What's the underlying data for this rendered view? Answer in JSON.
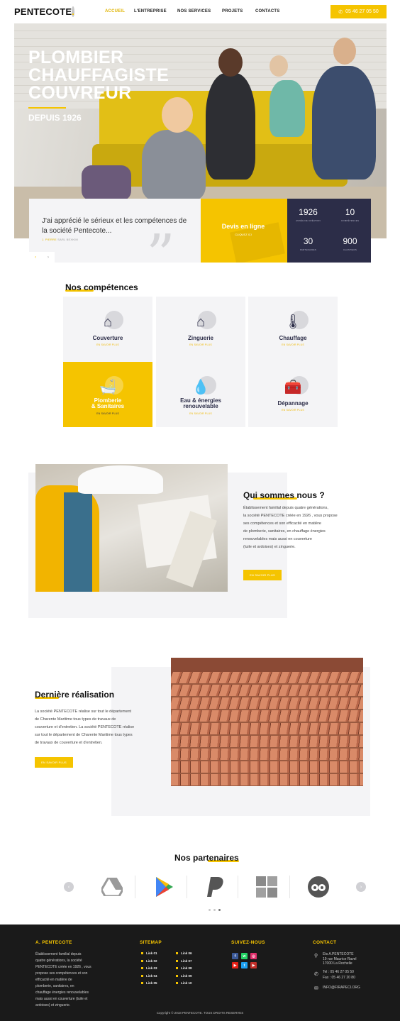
{
  "header": {
    "logo": "PENTECOTE",
    "nav": [
      "ACCUEIL",
      "L'ENTREPRISE",
      "NOS SERVICES",
      "PROJETS",
      "CONTACTS"
    ],
    "phone": "05 46 27 05 50"
  },
  "hero": {
    "title": "PLOMBIER CHAUFFAGISTE COUVREUR",
    "subtitle": "DEPUIS 1926"
  },
  "testimonial": {
    "text": "J'ai apprécié le sérieux et les compétences de la société Pentecote...",
    "author_name": "J. PIERRE",
    "author_company": "SARL BEXKIM"
  },
  "devis": {
    "title": "Devis en ligne",
    "subtitle": "CLIQUEZ ICI"
  },
  "stats": [
    {
      "value": "1926",
      "label": "ANNÉE DE CRÉATION"
    },
    {
      "value": "10",
      "label": "COMPÉTENCES"
    },
    {
      "value": "30",
      "label": "PARTENAIRES"
    },
    {
      "value": "900",
      "label": "CHANTIERS"
    }
  ],
  "competences": {
    "title": "Nos compétences",
    "more_label": "EN SAVOIR PLUS",
    "items": [
      {
        "title": "Couverture",
        "icon": "roof-tiles-icon"
      },
      {
        "title": "Zinguerie",
        "icon": "house-icon"
      },
      {
        "title": "Chauffage",
        "icon": "thermometer-icon"
      },
      {
        "title": "Plomberie",
        "title2": "& Sanitaires",
        "icon": "bathtub-icon"
      },
      {
        "title": "Eau & énergies",
        "title2": "renouvelable",
        "icon": "water-hand-icon"
      },
      {
        "title": "Dépannage",
        "icon": "toolbox-icon"
      }
    ]
  },
  "about": {
    "title": "Qui sommes nous ?",
    "lines": [
      "Établissement familial depuis quatre générations,",
      "la société PENTECOTE créée en 1926 , vous propose",
      "ses compétences et son efficacité en matière",
      "de plomberie, sanitaires, en chauffage énergies",
      "renouvelables mais aussi en couverture",
      " (tuile et ardoises) et zinguerie."
    ],
    "button": "EN SAVOIR PLUS"
  },
  "realisation": {
    "title": "Dernière réalisation",
    "lines": [
      "La société PENTECOTE réalise sur tout le département",
      "de Charente Maritime tous types de travaux de",
      "couverture et d'entretien. La société PENTECOTE réalise",
      "sur tout le département de Charente Maritime tous types",
      "de travaux de couverture et d'entretien."
    ],
    "button": "EN SAVOIR PLUS"
  },
  "partners": {
    "title": "Nos partenaires",
    "logos": [
      "google-drive-icon",
      "google-play-icon",
      "paypal-icon",
      "windows-icon",
      "tripadvisor-icon"
    ]
  },
  "footer": {
    "col1_title": "A. PENTECOTE",
    "col1_lines": [
      "Établissement familial depuis",
      "quatre générations, la société",
      "PENTECOTE créée en 1926 , vous",
      "propose ses compétences et son",
      "efficacité en matière de",
      "plomberie, sanitaires, en",
      "chauffage énergies renouvelables",
      "mais aussi en couverture (tuile et",
      "ardoises) et zinguerie."
    ],
    "sitemap_title": "SITEMAP",
    "links_left": [
      "Link 01",
      "Link 02",
      "Link 03",
      "Link 04",
      "Link 05"
    ],
    "links_right": [
      "Link 06",
      "Link 07",
      "Link 08",
      "Link 09",
      "Link 10"
    ],
    "social_title": "SUIVEZ-NOUS",
    "contact_title": "CONTACT",
    "address": [
      "Ets A.PENTECOTE",
      "19 rue Maurice Ravel",
      "17000 La Rochelle"
    ],
    "tel": "Tel : 05 46 27 05 50",
    "fax": "Fax : 05 46 27 20 80",
    "email": "INFO@FIRAPECI.ORG",
    "copyright": "Copyright © 2018 PENTECOTE. TOUS DROITS RESERVES"
  },
  "colors": {
    "accent": "#f5c400",
    "navy": "#2c2d48",
    "footer": "#1a1a1a"
  }
}
